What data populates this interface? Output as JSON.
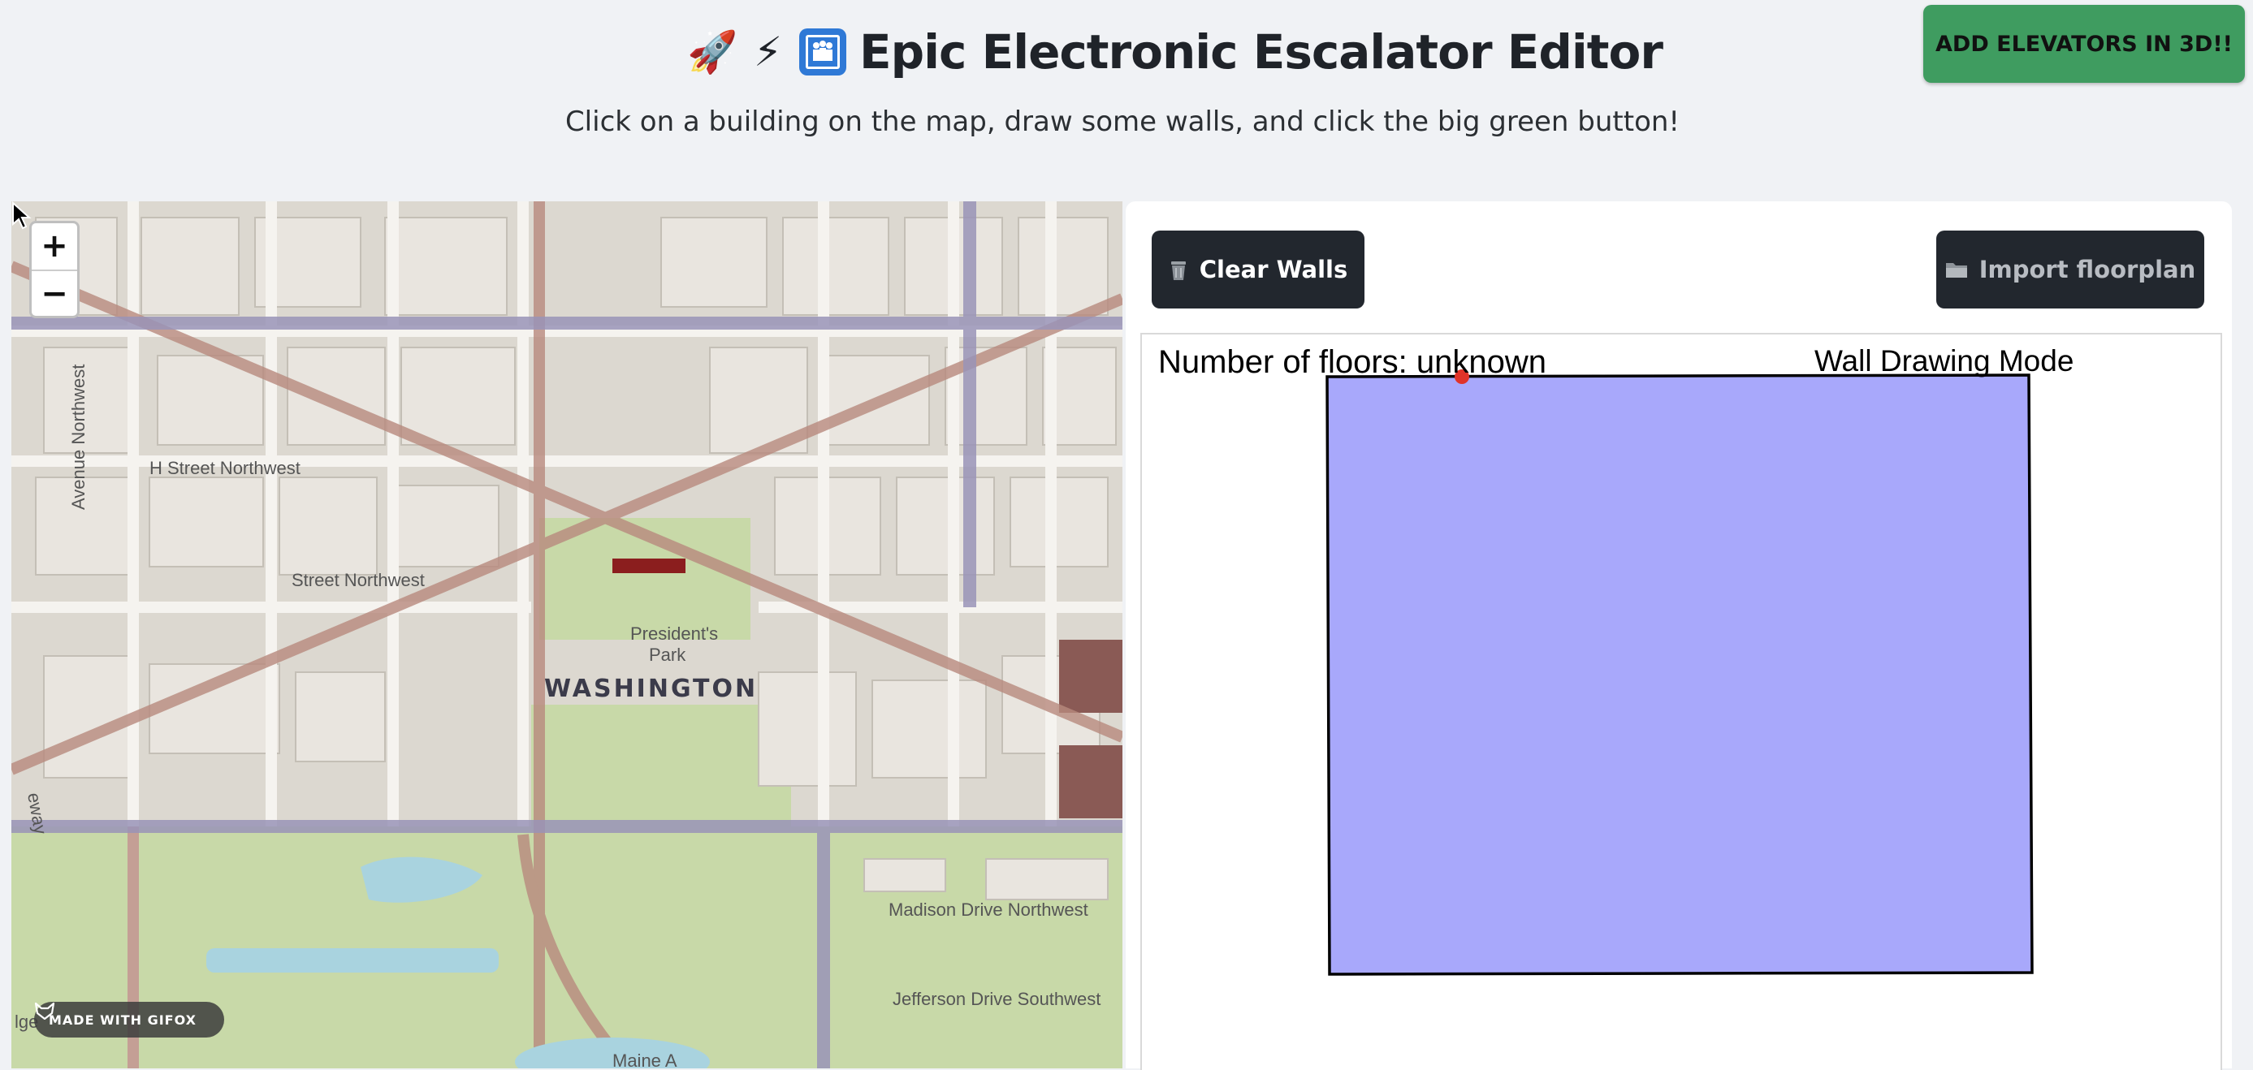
{
  "header": {
    "title": "Epic Electronic Escalator Editor",
    "emojis": [
      "🚀",
      "⚡",
      "🛗"
    ],
    "subtitle": "Click on a building on the map, draw some walls, and click the big green button!",
    "cta_label": "ADD ELEVATORS IN 3D!!"
  },
  "map": {
    "zoom_in": "+",
    "zoom_out": "−",
    "labels": {
      "h_street": "H Street Northwest",
      "i_street": "Street Northwest",
      "avenue": "Avenue Northwest",
      "presidents_park_1": "President's",
      "presidents_park_2": "Park",
      "washington": "WASHINGTON",
      "madison": "Madison Drive Northwest",
      "jefferson": "Jefferson Drive Southwest",
      "maine": "Maine A",
      "parkway": "eway",
      "edge": "lge"
    },
    "watermark": "MADE WITH GIFOX"
  },
  "editor": {
    "clear_label": "Clear Walls",
    "clear_icon": "trash-icon",
    "import_label": "Import floorplan",
    "import_icon": "folder-icon",
    "floors_label": "Number of floors: unknown",
    "mode_label": "Wall Drawing Mode",
    "polygon_fill": "#a8a8fb",
    "vertex_color": "#e0332a"
  },
  "colors": {
    "cta": "#3f9c60",
    "dark_button": "#22272e",
    "background": "#f0f2f5"
  }
}
